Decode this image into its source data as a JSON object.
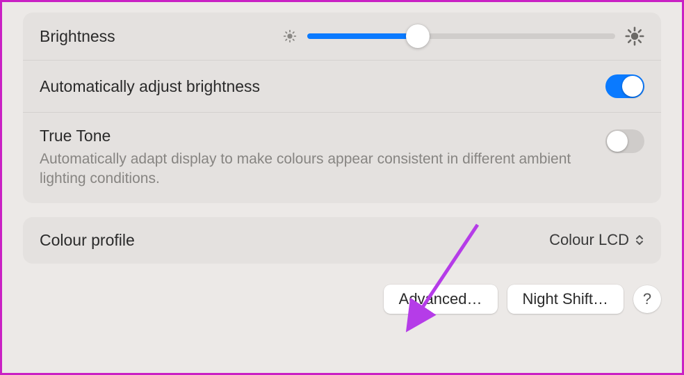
{
  "panel1": {
    "brightness": {
      "label": "Brightness",
      "value_percent": 36
    },
    "autoAdjust": {
      "label": "Automatically adjust brightness",
      "on": true
    },
    "trueTone": {
      "label": "True Tone",
      "desc": "Automatically adapt display to make colours appear consistent in different ambient lighting conditions.",
      "on": false
    }
  },
  "panel2": {
    "colourProfile": {
      "label": "Colour profile",
      "value": "Colour LCD"
    }
  },
  "buttons": {
    "advanced": "Advanced…",
    "nightShift": "Night Shift…",
    "help": "?"
  },
  "icons": {
    "sunLowColor": "#8a8885",
    "sunHighColor": "#6b6966",
    "accent": "#0a7aff"
  }
}
